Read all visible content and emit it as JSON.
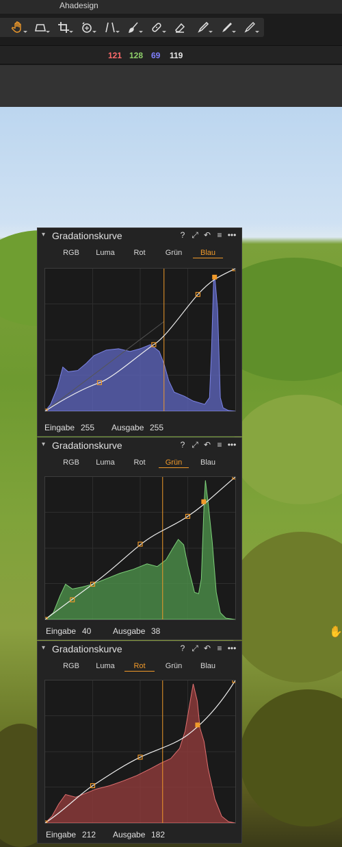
{
  "app": {
    "title": "Ahadesign"
  },
  "toolbar": {
    "tools": [
      {
        "name": "hand-tool-icon",
        "active": true
      },
      {
        "name": "crop-preset-icon"
      },
      {
        "name": "crop-icon"
      },
      {
        "name": "rotate-icon"
      },
      {
        "name": "keystone-icon"
      },
      {
        "name": "brush-icon"
      },
      {
        "name": "heal-icon"
      },
      {
        "name": "eraser-icon"
      },
      {
        "name": "picker-icon"
      },
      {
        "name": "color-pick-icon"
      },
      {
        "name": "annotate-icon"
      }
    ]
  },
  "readout": {
    "r": "121",
    "g": "128",
    "b": "69",
    "l": "119"
  },
  "colors": {
    "accent": "#f19a2a",
    "red": "#ff6b6b",
    "green": "#8fd06a",
    "blue": "#8080ff"
  },
  "panels": [
    {
      "title": "Gradationskurve",
      "tabs": [
        "RGB",
        "Luma",
        "Rot",
        "Grün",
        "Blau"
      ],
      "active_tab": "Blau",
      "input_label": "Eingabe",
      "input_value": "255",
      "output_label": "Ausgabe",
      "output_value": "255"
    },
    {
      "title": "Gradationskurve",
      "tabs": [
        "RGB",
        "Luma",
        "Rot",
        "Grün",
        "Blau"
      ],
      "active_tab": "Grün",
      "input_label": "Eingabe",
      "input_value": "40",
      "output_label": "Ausgabe",
      "output_value": "38"
    },
    {
      "title": "Gradationskurve",
      "tabs": [
        "RGB",
        "Luma",
        "Rot",
        "Grün",
        "Blau"
      ],
      "active_tab": "Rot",
      "input_label": "Eingabe",
      "input_value": "212",
      "output_label": "Ausgabe",
      "output_value": "182"
    }
  ],
  "header_icons": [
    "help-icon",
    "expand-icon",
    "reset-icon",
    "menu-icon",
    "more-icon"
  ],
  "header_glyphs": [
    "?",
    "⤢",
    "↶",
    "≡",
    "•••"
  ]
}
